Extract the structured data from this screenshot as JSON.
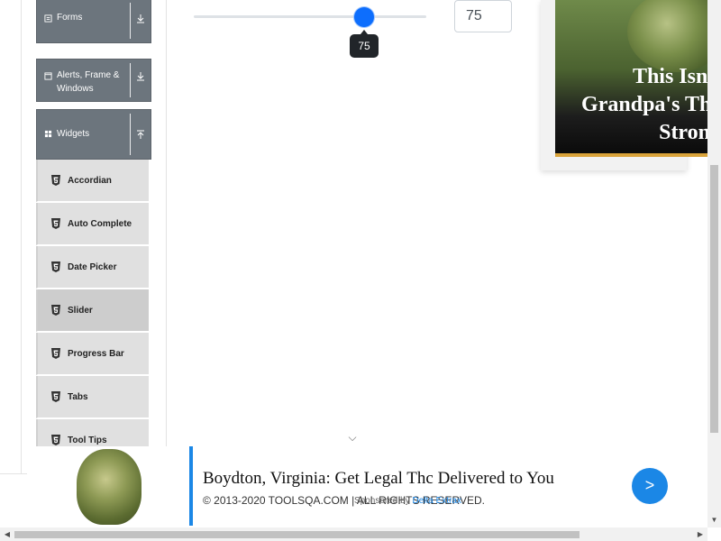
{
  "sidebar": {
    "groups": [
      {
        "label": "Forms",
        "icon": "form-icon",
        "arrow": "expand-icon"
      },
      {
        "label_line1": "Alerts, Frame &",
        "label_line2": "Windows",
        "icon": "window-icon",
        "arrow": "expand-icon"
      },
      {
        "label": "Widgets",
        "icon": "grid-icon",
        "arrow": "collapse-icon"
      }
    ],
    "items": [
      {
        "label": "Accordian"
      },
      {
        "label": "Auto Complete"
      },
      {
        "label": "Date Picker"
      },
      {
        "label": "Slider",
        "active": true
      },
      {
        "label": "Progress Bar"
      },
      {
        "label": "Tabs"
      },
      {
        "label": "Tool Tips"
      }
    ]
  },
  "slider": {
    "value": 75,
    "min": 0,
    "max": 100,
    "tooltip": "75",
    "value_box": "75",
    "accent": "#0d6efd"
  },
  "ad_right": {
    "headline": "This Isn't\nGrandpa's The\nStrong"
  },
  "banner": {
    "title": "Boydton, Virginia: Get Legal Thc Delivered to You",
    "sponsor_prefix": "Sponsored by",
    "sponsor_name": "Delta Extrax",
    "button": ">",
    "accent": "#1b87e6"
  },
  "footer": {
    "copyright": "© 2013-2020 TOOLSQA.COM | ALL RIGHTS RESERVED."
  },
  "scrollbars": {
    "vertical_down": "▼",
    "horizontal_left": "◀",
    "horizontal_right": "▶"
  },
  "misc": {
    "chevron": "⌵"
  }
}
